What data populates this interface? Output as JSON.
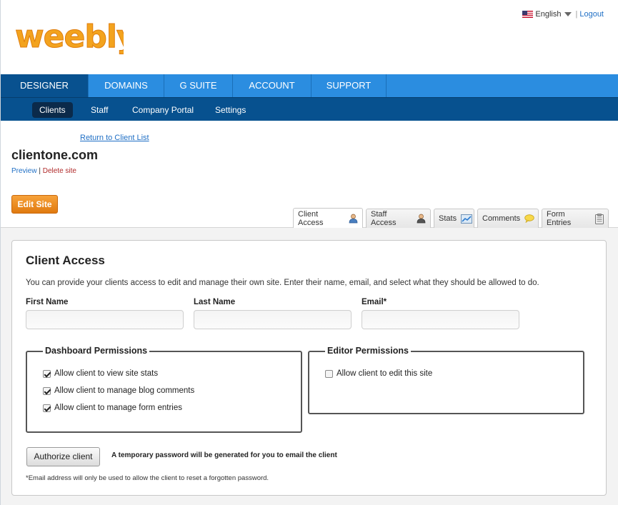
{
  "topbar": {
    "language": "English",
    "separator": "|",
    "logout": "Logout"
  },
  "logo": {
    "text": "weebly"
  },
  "main_nav": {
    "items": [
      {
        "label": "DESIGNER",
        "active": true
      },
      {
        "label": "DOMAINS",
        "active": false
      },
      {
        "label": "G SUITE",
        "active": false
      },
      {
        "label": "ACCOUNT",
        "active": false
      },
      {
        "label": "SUPPORT",
        "active": false
      }
    ]
  },
  "sub_nav": {
    "items": [
      {
        "label": "Clients",
        "active": true
      },
      {
        "label": "Staff",
        "active": false
      },
      {
        "label": "Company Portal",
        "active": false
      },
      {
        "label": "Settings",
        "active": false
      }
    ]
  },
  "site": {
    "return_link": "Return to Client List",
    "domain": "clientone.com",
    "preview": "Preview",
    "separator": "|",
    "delete": "Delete site",
    "edit_button": "Edit Site"
  },
  "tabs": [
    {
      "label": "Client Access",
      "icon": "person-icon",
      "active": true
    },
    {
      "label": "Staff Access",
      "icon": "person-icon",
      "active": false
    },
    {
      "label": "Stats",
      "icon": "chart-icon",
      "active": false
    },
    {
      "label": "Comments",
      "icon": "speech-bubble-icon",
      "active": false
    },
    {
      "label": "Form Entries",
      "icon": "clipboard-icon",
      "active": false
    }
  ],
  "client_access": {
    "title": "Client Access",
    "description": "You can provide your clients access to edit and manage their own site. Enter their name, email, and select what they should be allowed to do.",
    "fields": {
      "first_name": {
        "label": "First Name",
        "value": ""
      },
      "last_name": {
        "label": "Last Name",
        "value": ""
      },
      "email": {
        "label": "Email*",
        "value": ""
      }
    },
    "dashboard_permissions": {
      "legend": "Dashboard Permissions",
      "options": [
        {
          "label": "Allow client to view site stats",
          "checked": true
        },
        {
          "label": "Allow client to manage blog comments",
          "checked": true
        },
        {
          "label": "Allow client to manage form entries",
          "checked": true
        }
      ]
    },
    "editor_permissions": {
      "legend": "Editor Permissions",
      "options": [
        {
          "label": "Allow client to edit this site",
          "checked": false
        }
      ]
    },
    "authorize_button": "Authorize client",
    "password_note": "A temporary password will be generated for you to email the client",
    "footnote": "*Email address will only be used to allow the client to reset a forgotten password."
  },
  "colors": {
    "nav_blue": "#2b8de0",
    "nav_active": "#08518f",
    "subnav_blue": "#07518f",
    "logo_orange": "#f5a623",
    "edit_button": "#e8861d",
    "link_blue": "#1f6fc5",
    "delete_red": "#b02a2a"
  }
}
